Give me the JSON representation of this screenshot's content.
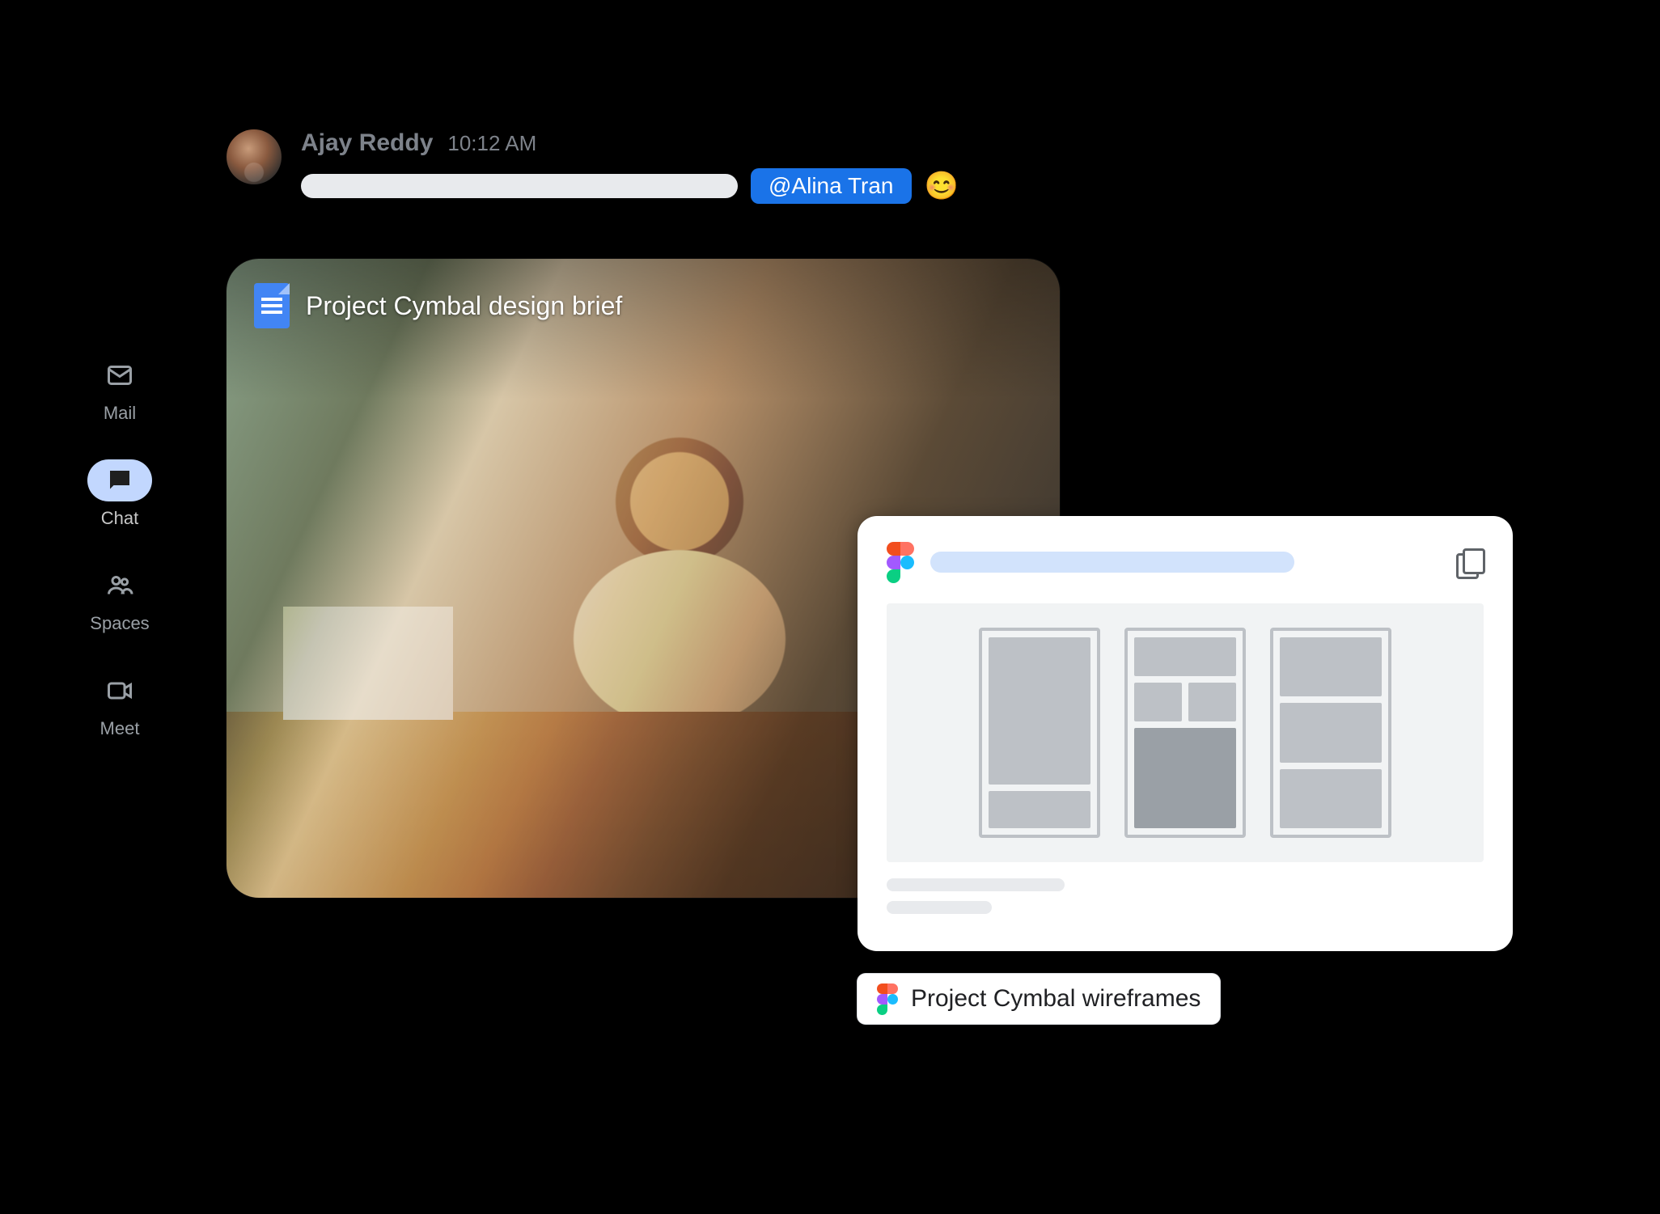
{
  "sidebar": {
    "items": [
      {
        "label": "Mail"
      },
      {
        "label": "Chat"
      },
      {
        "label": "Spaces"
      },
      {
        "label": "Meet"
      }
    ],
    "active_index": 1
  },
  "message": {
    "sender": "Ajay Reddy",
    "time": "10:12 AM",
    "mention": "@Alina Tran",
    "emoji": "😊"
  },
  "attachment": {
    "doc_title": "Project Cymbal design brief"
  },
  "figma_chip": {
    "label": "Project Cymbal wireframes"
  }
}
